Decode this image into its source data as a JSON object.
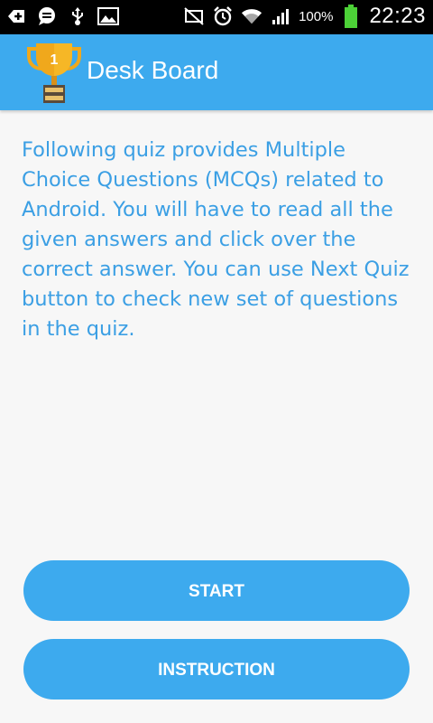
{
  "status_bar": {
    "battery_percent": "100%",
    "time": "22:23",
    "icons": [
      "add-notification-icon",
      "chat-icon",
      "usb-icon",
      "image-icon",
      "mute-icon",
      "alarm-icon",
      "wifi-icon",
      "signal-icon",
      "battery-icon"
    ]
  },
  "app_bar": {
    "title": "Desk Board",
    "logo_icon": "trophy-icon",
    "logo_number": "1"
  },
  "content": {
    "description": "Following quiz provides Multiple Choice Questions (MCQs) related to Android. You will have to read all the given answers and click over the correct answer. You can use Next Quiz button to check new set of questions in the quiz."
  },
  "buttons": {
    "start_label": "START",
    "instruction_label": "INSTRUCTION"
  },
  "colors": {
    "accent": "#3daaee",
    "text_blue": "#3b9fe4",
    "background": "#f7f7f7",
    "status_bar": "#000000",
    "trophy_gold": "#f0a81c"
  }
}
